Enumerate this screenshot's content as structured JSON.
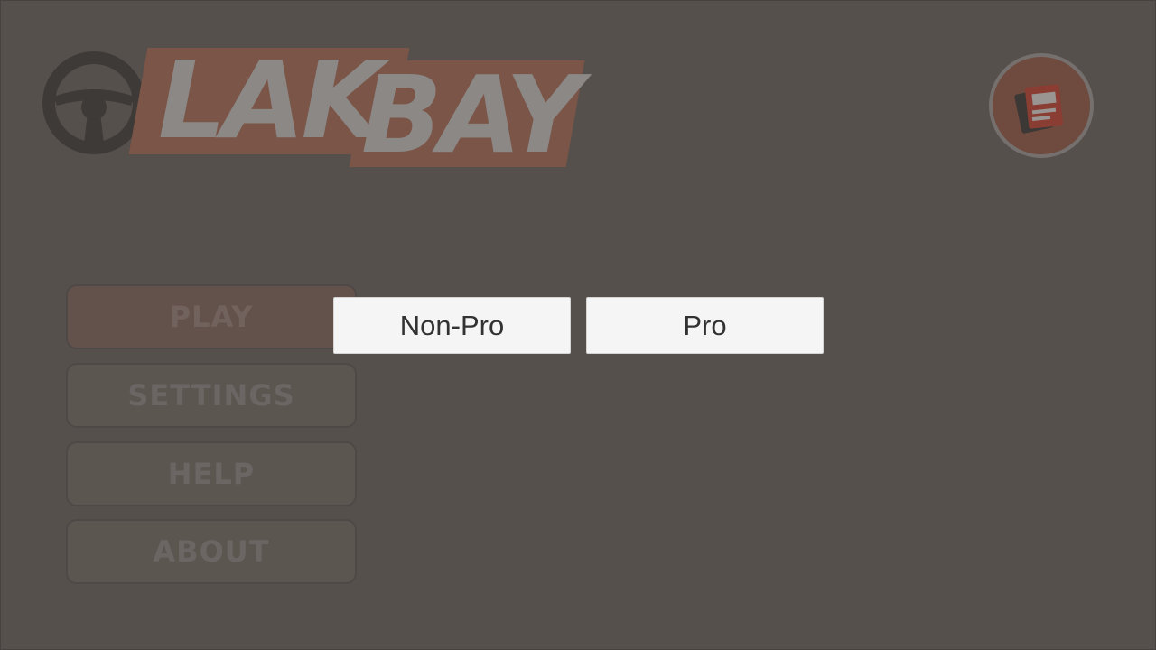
{
  "logo": {
    "text_part1": "LAK",
    "text_part2": "BAY",
    "icon": "steering-wheel-icon",
    "band_color": "#7b5547",
    "text_color": "#8b8886"
  },
  "top_right_button": {
    "icon": "license-cards-icon",
    "ring_color": "#75706e",
    "fill_color": "#6f4a3e"
  },
  "main_menu": {
    "play_label": "PLAY",
    "settings_label": "SETTINGS",
    "help_label": "HELP",
    "about_label": "ABOUT"
  },
  "mode_select": {
    "nonpro_label": "Non-Pro",
    "pro_label": "Pro"
  },
  "colors": {
    "overlay_background": "#56504d",
    "mode_button_background": "#f5f5f5",
    "mode_button_text": "#323232"
  }
}
